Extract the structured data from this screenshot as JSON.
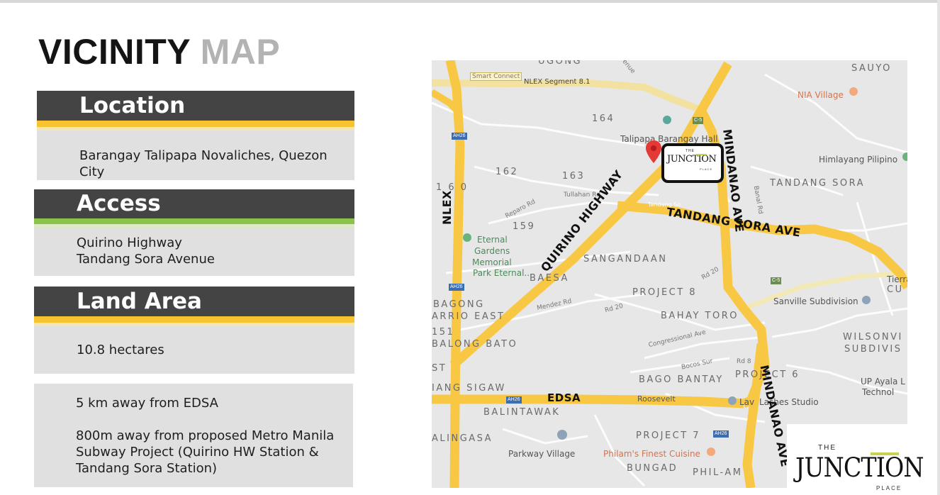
{
  "slide": {
    "title_part1": "VICINITY",
    "title_part2": "MAP",
    "accent_yellow": "#f7c331",
    "accent_green": "#8bc34a",
    "header_bg": "#444444",
    "box_bg": "#e0e0e0"
  },
  "sections": {
    "location": {
      "heading": "Location",
      "text": "Barangay Talipapa Novaliches, Quezon City"
    },
    "access": {
      "heading": "Access",
      "line1": "Quirino Highway",
      "line2": "Tandang Sora Avenue"
    },
    "land_area": {
      "heading": "Land Area",
      "text": "10.8 hectares"
    },
    "notes": {
      "line1": "5 km away from EDSA",
      "line2": "800m away from proposed Metro Manila",
      "line3": "Subway Project (Quirino HW Station &",
      "line4": "Tandang Sora Station)"
    }
  },
  "map": {
    "road_color": "#f8c845",
    "roads": {
      "nlex": "NLEX",
      "quirino": "QUIRINO HIGHWAY",
      "tandang_sora": "TANDANG SORA AVE",
      "mindanao_top": "MINDANAO AVE",
      "mindanao_bottom": "MINDANAO AVE",
      "edsa": "EDSA"
    },
    "areas": {
      "uggong": "UGONG",
      "sauyo": "SAUYO",
      "a164": "164",
      "a162": "162",
      "a163": "163",
      "a160": "1 6 0",
      "a159": "159",
      "tandang_sora": "TANDANG SORA",
      "sangandaan": "SANGANDAAN",
      "baesa": "BAESA",
      "project8": "PROJECT 8",
      "bagong": "BAGONG",
      "barrio_east": "ARRIO EAST",
      "a151": "151",
      "balong_bato": "BALONG BATO",
      "bahay_toro": "BAHAY TORO",
      "wilsonvi": "WILSONVI",
      "subdivis": "SUBDIVIS",
      "st": "ST",
      "bago_bantay": "BAGO BANTAY",
      "project6": "PROJECT 6",
      "sigaw": "IANG SIGAW",
      "balintawak": "BALINTAWAK",
      "alingasa": "ALINGASA",
      "project7": "PROJECT 7",
      "bungad": "BUNGAD",
      "phil_am": "PHIL-AM"
    },
    "pois": {
      "smart_connect": "Smart Connect",
      "nlex_segment": "NLEX Segment 8.1",
      "venue": "venue",
      "nia_village": "NIA Village",
      "talipapa_hall": "Talipapa Barangay Hall",
      "himlayang": "Himlayang Pilipino",
      "eternal": "Eternal",
      "gardens": "Gardens",
      "memorial": "Memorial",
      "park_eternal": "Park Eternal...",
      "sanville": "Sanville Subdivision",
      "up_ayala": "UP Ayala L",
      "technol": "Technol",
      "lashes": "Lashes Studio",
      "lav": "Lav",
      "parkway": "Parkway Village",
      "philams": "Philam's Finest Cuisine",
      "roosevelt": "Roosevelt",
      "tierra": "Tierra",
      "cu": "CU"
    },
    "streets": {
      "tullahan": "Tullahan Rd",
      "reparo": "Reparo Rd",
      "mendez": "Mendez Rd",
      "rd20a": "Rd 20",
      "rd20b": "Rd 20",
      "congressional": "Congressional Ave",
      "bocos_sur": "Bocos Sur",
      "rd8": "Rd 8",
      "banal": "Banal Rd",
      "tandang_small": "Tandang So"
    },
    "badges": {
      "ah26_a": "AH26",
      "ah26_b": "AH26",
      "ah26_c": "AH26",
      "ah26_d": "AH26",
      "c5_a": "C-5",
      "c5_b": "C-5"
    },
    "callout": {
      "the": "THE",
      "junction": "JUNCTION",
      "place": "PLACE"
    }
  },
  "logo": {
    "the": "THE",
    "junction": "JUNCTION",
    "place": "PLACE"
  }
}
